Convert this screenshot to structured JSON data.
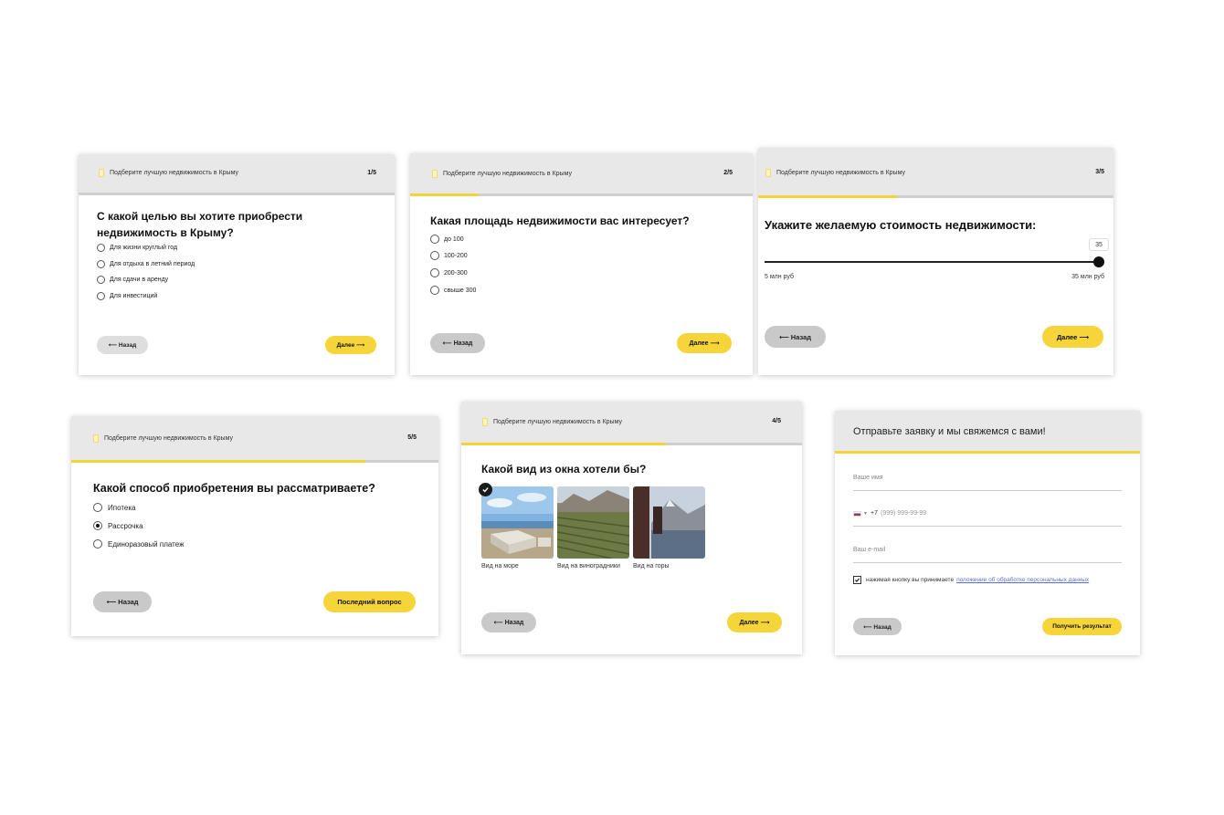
{
  "common": {
    "header_title": "Подберите лучшую недвижимость в Крыму",
    "back_label": "⟵ Назад",
    "next_label": "Далее ⟶",
    "accent_color": "#f6d23a"
  },
  "step1": {
    "step": "1/5",
    "progress": 0.0,
    "question": "С какой целью вы хотите приобрести недвижимость в Крыму?",
    "options": [
      "Для жизни круглый год",
      "Для отдыха в летний период",
      "Для сдачи в аренду",
      "Для инвестиций"
    ]
  },
  "step2": {
    "step": "2/5",
    "progress": 0.2,
    "question": "Какая площадь недвижимости вас интересует?",
    "options": [
      "до 100",
      "100-200",
      "200-300",
      "свыше 300"
    ]
  },
  "step3": {
    "step": "3/5",
    "progress": 0.39,
    "question": "Укажите желаемую стоимость недвижимости:",
    "slider_value": "35",
    "slider_fraction": 1.0,
    "min_label": "5 млн руб",
    "max_label": "35 млн руб"
  },
  "step5": {
    "step": "5/5",
    "progress": 0.8,
    "question": "Какой способ приобретения вы рассматриваете?",
    "options": [
      "Ипотека",
      "Рассрочка",
      "Единоразовый платеж"
    ],
    "selected_index": 1,
    "next_label": "Последний вопрос"
  },
  "step4": {
    "step": "4/5",
    "progress": 0.6,
    "question": "Какой вид из окна хотели бы?",
    "views": [
      "Вид на море",
      "Вид на виноградники",
      "Вид на горы"
    ],
    "selected_index": 0
  },
  "form": {
    "title": "Отправьте заявку и мы свяжемся с вами!",
    "name_placeholder": "Ваше имя",
    "phone_prefix": "+7",
    "phone_placeholder": "(999) 999-99-99",
    "email_placeholder": "Ваш e-mail",
    "consent_text": "нажимая кнопку вы принимаете",
    "consent_link": "положение об обработке персональных данных",
    "submit_label": "Получить результат"
  }
}
